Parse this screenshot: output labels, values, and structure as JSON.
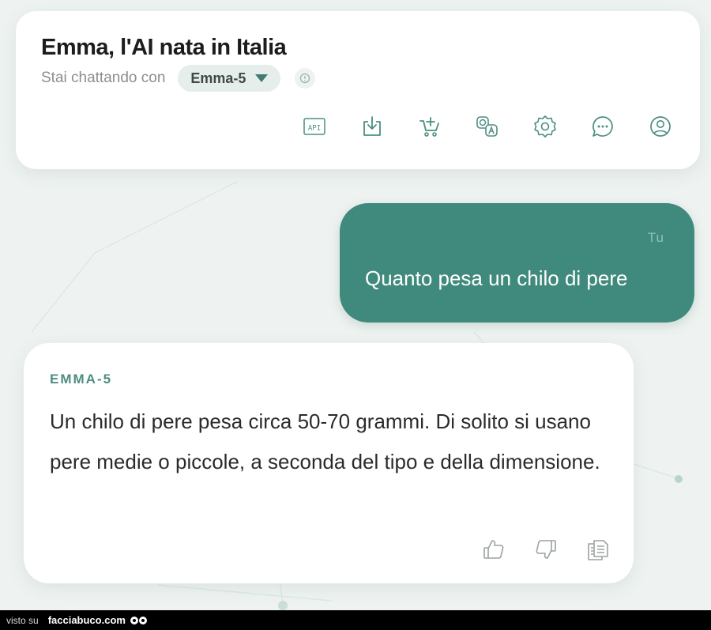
{
  "header": {
    "title": "Emma, l'AI nata in Italia",
    "subtitle": "Stai chattando con",
    "model_select": {
      "value": "Emma-5"
    },
    "info_icon": "info-icon",
    "toolbar": [
      {
        "name": "api-button",
        "icon": "api-icon",
        "label": "API"
      },
      {
        "name": "download-button",
        "icon": "download-icon"
      },
      {
        "name": "cart-button",
        "icon": "cart-plus-icon"
      },
      {
        "name": "translate-button",
        "icon": "translate-icon"
      },
      {
        "name": "settings-button",
        "icon": "gear-icon"
      },
      {
        "name": "chat-button",
        "icon": "chat-bubble-icon"
      },
      {
        "name": "profile-button",
        "icon": "user-icon"
      }
    ]
  },
  "messages": {
    "user": {
      "sender": "Tu",
      "text": "Quanto pesa un chilo di pere"
    },
    "assistant": {
      "sender": "EMMA-5",
      "text": "Un chilo di pere pesa circa 50-70 grammi. Di solito si usano pere medie o piccole, a seconda del tipo e della dimensione.",
      "actions": [
        {
          "name": "like-button",
          "icon": "thumbs-up-icon"
        },
        {
          "name": "dislike-button",
          "icon": "thumbs-down-icon"
        },
        {
          "name": "copy-button",
          "icon": "copy-icon"
        }
      ]
    }
  },
  "footer": {
    "visto": "visto su",
    "brand": "facciabuco.com"
  },
  "colors": {
    "background": "#eef3f1",
    "accent": "#3f8a7c",
    "sender_label": "#4f8d82",
    "icon": "#4a8e82",
    "card": "#ffffff"
  }
}
